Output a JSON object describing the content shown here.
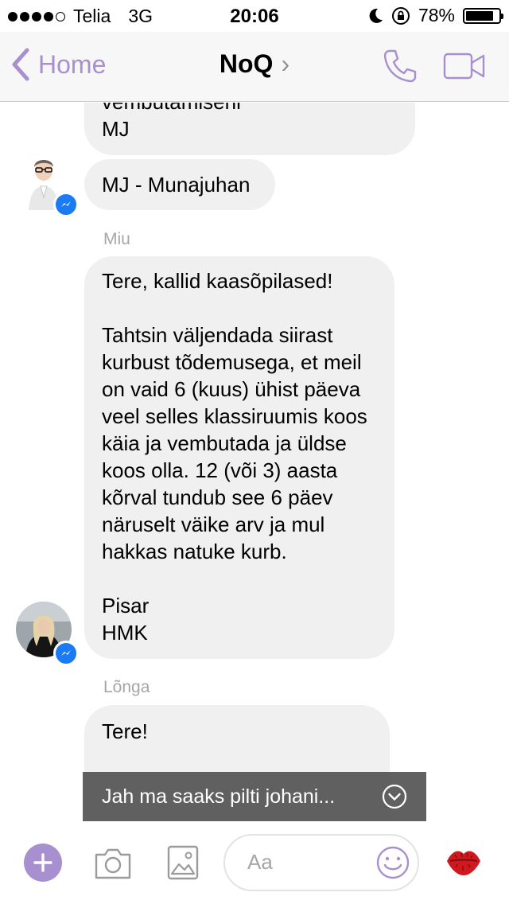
{
  "status_bar": {
    "carrier": "Telia",
    "network": "3G",
    "time": "20:06",
    "battery": "78%"
  },
  "nav": {
    "back_label": "Home",
    "title": "NoQ",
    "title_chevron": "›"
  },
  "messages": {
    "m1": {
      "line1": "vembutamiseni",
      "line2": "MJ"
    },
    "m2": {
      "text": "MJ - Munajuhan"
    },
    "miu_sender": "Miu",
    "miu_msg": {
      "l1": "Tere, kallid kaasõpilased!",
      "l2": "Tahtsin väljendada siirast",
      "l3": "kurbust tõdemusega, et meil",
      "l4": "on vaid 6 (kuus) ühist päeva",
      "l5": "veel selles klassiruumis koos",
      "l6": "käia ja vembutada ja üldse",
      "l7": "koos olla. 12 (või 3) aasta",
      "l8": "kõrval tundub see 6 päev",
      "l9": "näruselt väike arv ja mul",
      "l10": "hakkas natuke kurb.",
      "l11": "Pisar",
      "l12": "HMK"
    },
    "longa_sender": "Lõnga",
    "longa_msg": {
      "l1": "Tere!"
    }
  },
  "toast": {
    "text": "Jah ma saaks pilti johani..."
  },
  "composer": {
    "placeholder": "Aa"
  },
  "colors": {
    "accent": "#a88fd0",
    "bubble": "#f1f0f0",
    "messenger_badge": "#1a7bf5"
  },
  "icons": [
    "chevron-left-icon",
    "phone-icon",
    "video-icon",
    "plus-icon",
    "camera-icon",
    "image-icon",
    "emoji-icon",
    "kiss-icon",
    "chevron-down-circle-icon",
    "messenger-icon"
  ]
}
